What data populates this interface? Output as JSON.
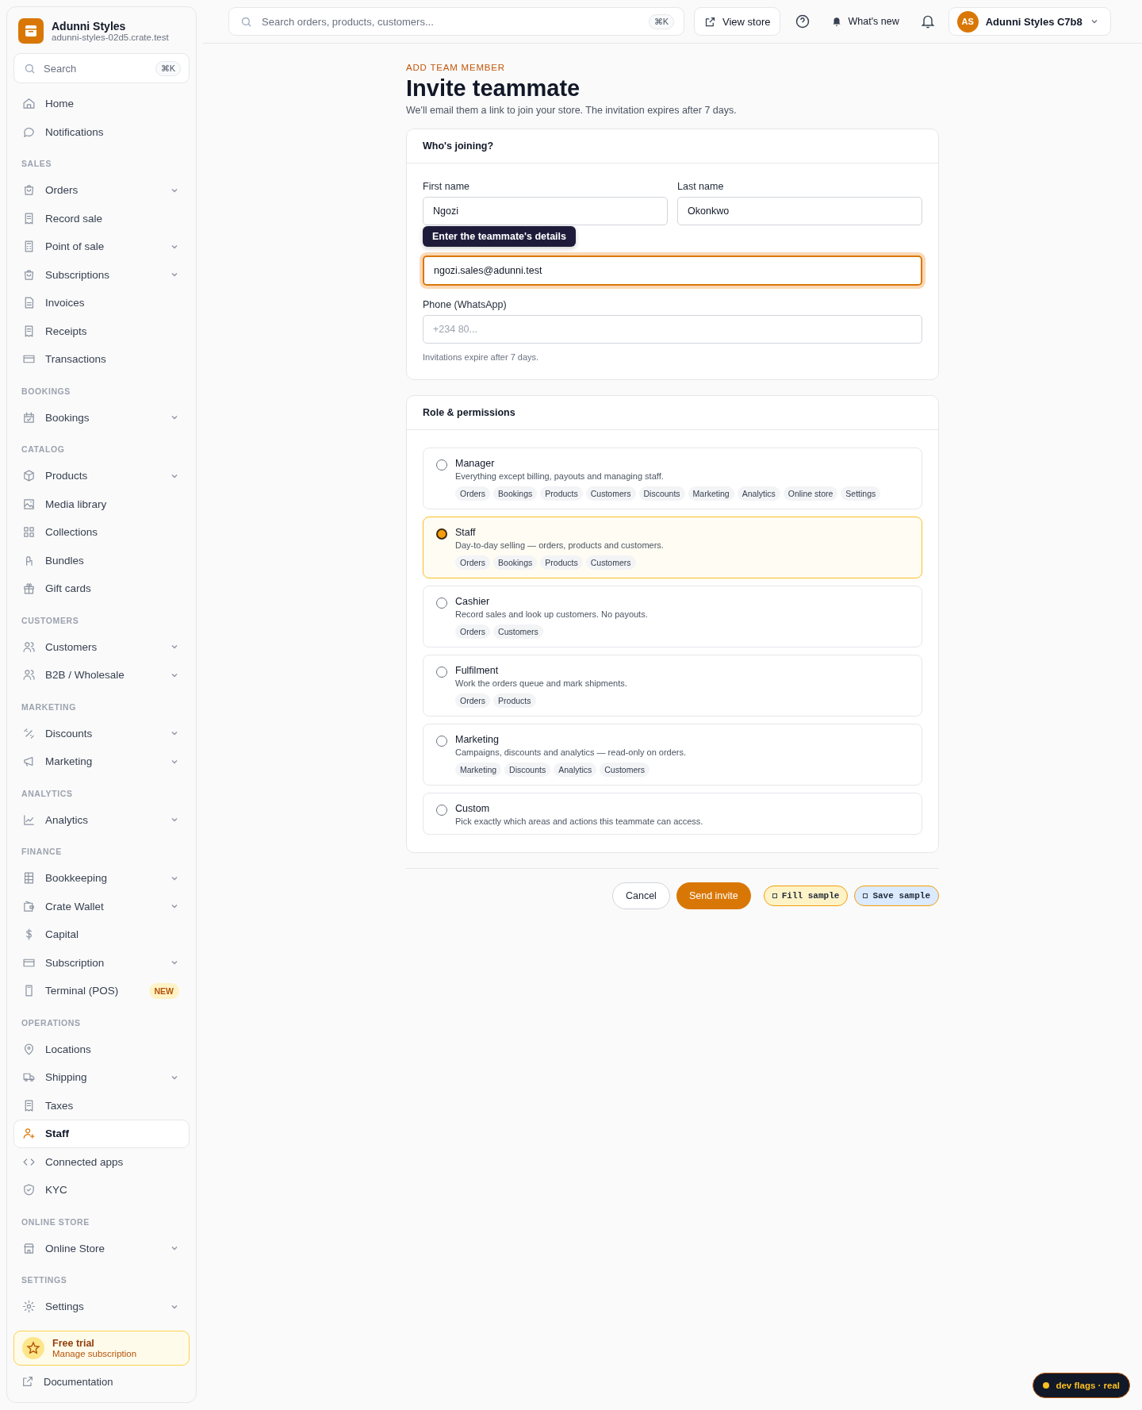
{
  "brand": {
    "name": "Adunni Styles",
    "domain": "adunni-styles-02d5.crate.test"
  },
  "sidebar": {
    "search": {
      "placeholder": "Search",
      "shortcut": "⌘K"
    },
    "sections": [
      {
        "items": [
          {
            "label": "Home",
            "expandable": false,
            "selected": false
          },
          {
            "label": "Notifications",
            "expandable": false,
            "selected": false
          }
        ]
      },
      {
        "heading": "SALES",
        "items": [
          {
            "label": "Orders",
            "expandable": true,
            "selected": false
          },
          {
            "label": "Record sale",
            "expandable": false,
            "selected": false
          },
          {
            "label": "Point of sale",
            "expandable": true,
            "selected": false
          },
          {
            "label": "Subscriptions",
            "expandable": true,
            "selected": false
          },
          {
            "label": "Invoices",
            "expandable": false,
            "selected": false
          },
          {
            "label": "Receipts",
            "expandable": false,
            "selected": false
          },
          {
            "label": "Transactions",
            "expandable": false,
            "selected": false
          }
        ]
      },
      {
        "heading": "BOOKINGS",
        "items": [
          {
            "label": "Bookings",
            "expandable": true,
            "selected": false
          }
        ]
      },
      {
        "heading": "CATALOG",
        "items": [
          {
            "label": "Products",
            "expandable": true,
            "selected": false
          },
          {
            "label": "Media library",
            "expandable": false,
            "selected": false
          },
          {
            "label": "Collections",
            "expandable": false,
            "selected": false
          },
          {
            "label": "Bundles",
            "expandable": false,
            "selected": false
          },
          {
            "label": "Gift cards",
            "expandable": false,
            "selected": false
          }
        ]
      },
      {
        "heading": "CUSTOMERS",
        "items": [
          {
            "label": "Customers",
            "expandable": true,
            "selected": false
          },
          {
            "label": "B2B / Wholesale",
            "expandable": true,
            "selected": false
          }
        ]
      },
      {
        "heading": "MARKETING",
        "items": [
          {
            "label": "Discounts",
            "expandable": true,
            "selected": false
          },
          {
            "label": "Marketing",
            "expandable": true,
            "selected": false
          }
        ]
      },
      {
        "heading": "ANALYTICS",
        "items": [
          {
            "label": "Analytics",
            "expandable": true,
            "selected": false
          }
        ]
      },
      {
        "heading": "FINANCE",
        "items": [
          {
            "label": "Bookkeeping",
            "expandable": true,
            "selected": false
          },
          {
            "label": "Crate Wallet",
            "expandable": true,
            "selected": false
          },
          {
            "label": "Capital",
            "expandable": false,
            "selected": false
          },
          {
            "label": "Subscription",
            "expandable": true,
            "selected": false
          },
          {
            "label": "Terminal (POS)",
            "expandable": false,
            "selected": false,
            "badge": "NEW"
          }
        ]
      },
      {
        "heading": "OPERATIONS",
        "items": [
          {
            "label": "Locations",
            "expandable": false,
            "selected": false
          },
          {
            "label": "Shipping",
            "expandable": true,
            "selected": false
          },
          {
            "label": "Taxes",
            "expandable": false,
            "selected": false
          },
          {
            "label": "Staff",
            "expandable": false,
            "selected": true
          },
          {
            "label": "Connected apps",
            "expandable": false,
            "selected": false
          },
          {
            "label": "KYC",
            "expandable": false,
            "selected": false
          }
        ]
      },
      {
        "heading": "ONLINE STORE",
        "items": [
          {
            "label": "Online Store",
            "expandable": true,
            "selected": false
          }
        ]
      },
      {
        "heading": "SETTINGS",
        "items": [
          {
            "label": "Settings",
            "expandable": true,
            "selected": false
          }
        ]
      }
    ],
    "trial": {
      "title": "Free trial",
      "link": "Manage subscription"
    },
    "documentation": "Documentation"
  },
  "topbar": {
    "search": {
      "placeholder": "Search orders, products, customers...",
      "shortcut": "⌘K"
    },
    "view_store": "View store",
    "whats_new": "What's new",
    "account": {
      "initials": "AS",
      "name": "Adunni Styles C7b8"
    }
  },
  "page": {
    "eyebrow": "ADD TEAM MEMBER",
    "title": "Invite teammate",
    "subtitle": "We'll email them a link to join your store. The invitation expires after 7 days."
  },
  "details_card": {
    "title": "Who's joining?",
    "rows": [
      [
        {
          "label": "First name",
          "value": "Ngozi",
          "focused": false
        },
        {
          "label": "Last name",
          "value": "Okonkwo",
          "focused": false
        }
      ],
      [
        {
          "value": "ngozi.sales@adunni.test",
          "focused": true,
          "tooltip": "Enter the teammate's details"
        }
      ],
      [
        {
          "label": "Phone (WhatsApp)",
          "placeholder": "+234 80...",
          "focused": false
        }
      ]
    ],
    "hint": "Invitations expire after 7 days."
  },
  "roles_card": {
    "title": "Role & permissions",
    "roles": [
      {
        "name": "Manager",
        "description": "Everything except billing, payouts and managing staff.",
        "selected": false,
        "permissions": [
          "Orders",
          "Bookings",
          "Products",
          "Customers",
          "Discounts",
          "Marketing",
          "Analytics",
          "Online store",
          "Settings"
        ]
      },
      {
        "name": "Staff",
        "description": "Day-to-day selling — orders, products and customers.",
        "selected": true,
        "permissions": [
          "Orders",
          "Bookings",
          "Products",
          "Customers"
        ]
      },
      {
        "name": "Cashier",
        "description": "Record sales and look up customers. No payouts.",
        "selected": false,
        "permissions": [
          "Orders",
          "Customers"
        ]
      },
      {
        "name": "Fulfilment",
        "description": "Work the orders queue and mark shipments.",
        "selected": false,
        "permissions": [
          "Orders",
          "Products"
        ]
      },
      {
        "name": "Marketing",
        "description": "Campaigns, discounts and analytics — read-only on orders.",
        "selected": false,
        "permissions": [
          "Marketing",
          "Discounts",
          "Analytics",
          "Customers"
        ]
      },
      {
        "name": "Custom",
        "description": "Pick exactly which areas and actions this teammate can access.",
        "selected": false
      }
    ]
  },
  "actions": {
    "cancel": "Cancel",
    "submit": "Send invite",
    "dev_buttons": [
      {
        "label": "Fill sample",
        "color": "#fef3c7"
      },
      {
        "label": "Save sample",
        "color": "#dbeafe"
      }
    ]
  },
  "dev_flags": "dev flags · real"
}
